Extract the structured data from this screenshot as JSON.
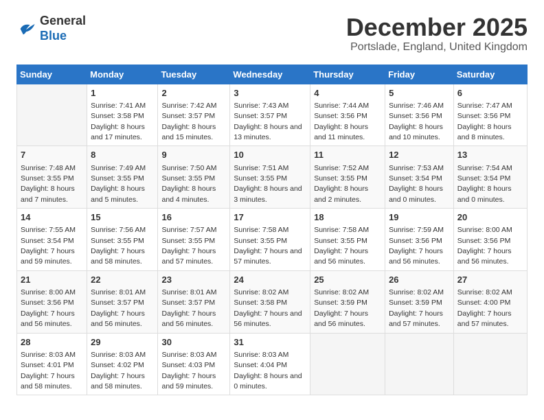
{
  "logo": {
    "general": "General",
    "blue": "Blue"
  },
  "title": "December 2025",
  "location": "Portslade, England, United Kingdom",
  "days_header": [
    "Sunday",
    "Monday",
    "Tuesday",
    "Wednesday",
    "Thursday",
    "Friday",
    "Saturday"
  ],
  "weeks": [
    [
      {
        "day": "",
        "sunrise": "",
        "sunset": "",
        "daylight": ""
      },
      {
        "day": "1",
        "sunrise": "Sunrise: 7:41 AM",
        "sunset": "Sunset: 3:58 PM",
        "daylight": "Daylight: 8 hours and 17 minutes."
      },
      {
        "day": "2",
        "sunrise": "Sunrise: 7:42 AM",
        "sunset": "Sunset: 3:57 PM",
        "daylight": "Daylight: 8 hours and 15 minutes."
      },
      {
        "day": "3",
        "sunrise": "Sunrise: 7:43 AM",
        "sunset": "Sunset: 3:57 PM",
        "daylight": "Daylight: 8 hours and 13 minutes."
      },
      {
        "day": "4",
        "sunrise": "Sunrise: 7:44 AM",
        "sunset": "Sunset: 3:56 PM",
        "daylight": "Daylight: 8 hours and 11 minutes."
      },
      {
        "day": "5",
        "sunrise": "Sunrise: 7:46 AM",
        "sunset": "Sunset: 3:56 PM",
        "daylight": "Daylight: 8 hours and 10 minutes."
      },
      {
        "day": "6",
        "sunrise": "Sunrise: 7:47 AM",
        "sunset": "Sunset: 3:56 PM",
        "daylight": "Daylight: 8 hours and 8 minutes."
      }
    ],
    [
      {
        "day": "7",
        "sunrise": "Sunrise: 7:48 AM",
        "sunset": "Sunset: 3:55 PM",
        "daylight": "Daylight: 8 hours and 7 minutes."
      },
      {
        "day": "8",
        "sunrise": "Sunrise: 7:49 AM",
        "sunset": "Sunset: 3:55 PM",
        "daylight": "Daylight: 8 hours and 5 minutes."
      },
      {
        "day": "9",
        "sunrise": "Sunrise: 7:50 AM",
        "sunset": "Sunset: 3:55 PM",
        "daylight": "Daylight: 8 hours and 4 minutes."
      },
      {
        "day": "10",
        "sunrise": "Sunrise: 7:51 AM",
        "sunset": "Sunset: 3:55 PM",
        "daylight": "Daylight: 8 hours and 3 minutes."
      },
      {
        "day": "11",
        "sunrise": "Sunrise: 7:52 AM",
        "sunset": "Sunset: 3:55 PM",
        "daylight": "Daylight: 8 hours and 2 minutes."
      },
      {
        "day": "12",
        "sunrise": "Sunrise: 7:53 AM",
        "sunset": "Sunset: 3:54 PM",
        "daylight": "Daylight: 8 hours and 0 minutes."
      },
      {
        "day": "13",
        "sunrise": "Sunrise: 7:54 AM",
        "sunset": "Sunset: 3:54 PM",
        "daylight": "Daylight: 8 hours and 0 minutes."
      }
    ],
    [
      {
        "day": "14",
        "sunrise": "Sunrise: 7:55 AM",
        "sunset": "Sunset: 3:54 PM",
        "daylight": "Daylight: 7 hours and 59 minutes."
      },
      {
        "day": "15",
        "sunrise": "Sunrise: 7:56 AM",
        "sunset": "Sunset: 3:55 PM",
        "daylight": "Daylight: 7 hours and 58 minutes."
      },
      {
        "day": "16",
        "sunrise": "Sunrise: 7:57 AM",
        "sunset": "Sunset: 3:55 PM",
        "daylight": "Daylight: 7 hours and 57 minutes."
      },
      {
        "day": "17",
        "sunrise": "Sunrise: 7:58 AM",
        "sunset": "Sunset: 3:55 PM",
        "daylight": "Daylight: 7 hours and 57 minutes."
      },
      {
        "day": "18",
        "sunrise": "Sunrise: 7:58 AM",
        "sunset": "Sunset: 3:55 PM",
        "daylight": "Daylight: 7 hours and 56 minutes."
      },
      {
        "day": "19",
        "sunrise": "Sunrise: 7:59 AM",
        "sunset": "Sunset: 3:56 PM",
        "daylight": "Daylight: 7 hours and 56 minutes."
      },
      {
        "day": "20",
        "sunrise": "Sunrise: 8:00 AM",
        "sunset": "Sunset: 3:56 PM",
        "daylight": "Daylight: 7 hours and 56 minutes."
      }
    ],
    [
      {
        "day": "21",
        "sunrise": "Sunrise: 8:00 AM",
        "sunset": "Sunset: 3:56 PM",
        "daylight": "Daylight: 7 hours and 56 minutes."
      },
      {
        "day": "22",
        "sunrise": "Sunrise: 8:01 AM",
        "sunset": "Sunset: 3:57 PM",
        "daylight": "Daylight: 7 hours and 56 minutes."
      },
      {
        "day": "23",
        "sunrise": "Sunrise: 8:01 AM",
        "sunset": "Sunset: 3:57 PM",
        "daylight": "Daylight: 7 hours and 56 minutes."
      },
      {
        "day": "24",
        "sunrise": "Sunrise: 8:02 AM",
        "sunset": "Sunset: 3:58 PM",
        "daylight": "Daylight: 7 hours and 56 minutes."
      },
      {
        "day": "25",
        "sunrise": "Sunrise: 8:02 AM",
        "sunset": "Sunset: 3:59 PM",
        "daylight": "Daylight: 7 hours and 56 minutes."
      },
      {
        "day": "26",
        "sunrise": "Sunrise: 8:02 AM",
        "sunset": "Sunset: 3:59 PM",
        "daylight": "Daylight: 7 hours and 57 minutes."
      },
      {
        "day": "27",
        "sunrise": "Sunrise: 8:02 AM",
        "sunset": "Sunset: 4:00 PM",
        "daylight": "Daylight: 7 hours and 57 minutes."
      }
    ],
    [
      {
        "day": "28",
        "sunrise": "Sunrise: 8:03 AM",
        "sunset": "Sunset: 4:01 PM",
        "daylight": "Daylight: 7 hours and 58 minutes."
      },
      {
        "day": "29",
        "sunrise": "Sunrise: 8:03 AM",
        "sunset": "Sunset: 4:02 PM",
        "daylight": "Daylight: 7 hours and 58 minutes."
      },
      {
        "day": "30",
        "sunrise": "Sunrise: 8:03 AM",
        "sunset": "Sunset: 4:03 PM",
        "daylight": "Daylight: 7 hours and 59 minutes."
      },
      {
        "day": "31",
        "sunrise": "Sunrise: 8:03 AM",
        "sunset": "Sunset: 4:04 PM",
        "daylight": "Daylight: 8 hours and 0 minutes."
      },
      {
        "day": "",
        "sunrise": "",
        "sunset": "",
        "daylight": ""
      },
      {
        "day": "",
        "sunrise": "",
        "sunset": "",
        "daylight": ""
      },
      {
        "day": "",
        "sunrise": "",
        "sunset": "",
        "daylight": ""
      }
    ]
  ]
}
